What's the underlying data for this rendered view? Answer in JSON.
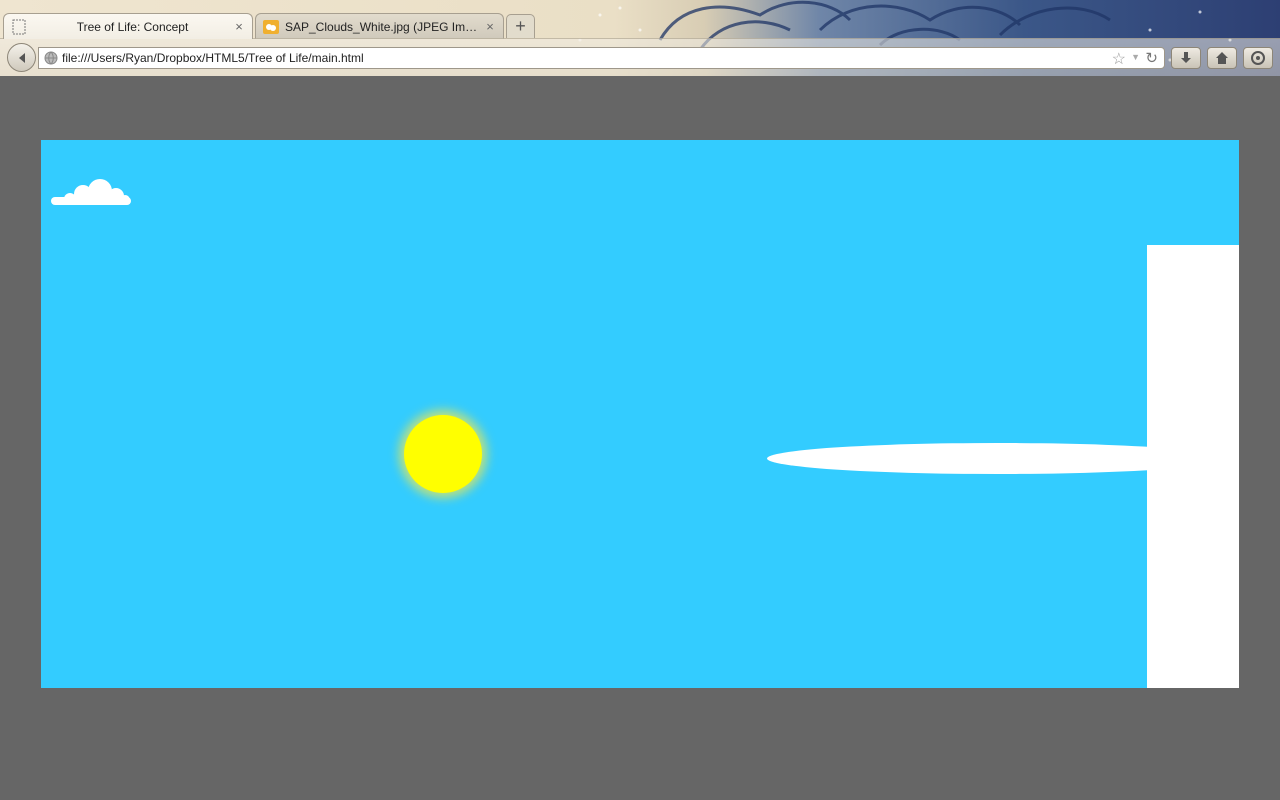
{
  "browser": {
    "tabs": [
      {
        "title": "Tree of Life: Concept",
        "close": "×",
        "active": true,
        "icon": "blank-page-icon"
      },
      {
        "title": "SAP_Clouds_White.jpg (JPEG Ima…",
        "close": "×",
        "active": false,
        "icon": "image-icon"
      }
    ],
    "new_tab_label": "+",
    "url": "file:///Users/Ryan/Dropbox/HTML5/Tree of Life/main.html",
    "icons": [
      "back-arrow-icon",
      "globe-icon",
      "star-icon",
      "dropdown-arrow-icon",
      "reload-icon",
      "download-icon",
      "home-icon",
      "addon-icon"
    ],
    "theme": "great-wave-persona"
  },
  "scene": {
    "colors": {
      "page_background": "#666666",
      "sky": "#33ccff",
      "sun": "#ffff00",
      "cloud": "#ffffff"
    },
    "elements": [
      "small-cloud",
      "sun",
      "long-cloud",
      "white-pillar"
    ]
  }
}
